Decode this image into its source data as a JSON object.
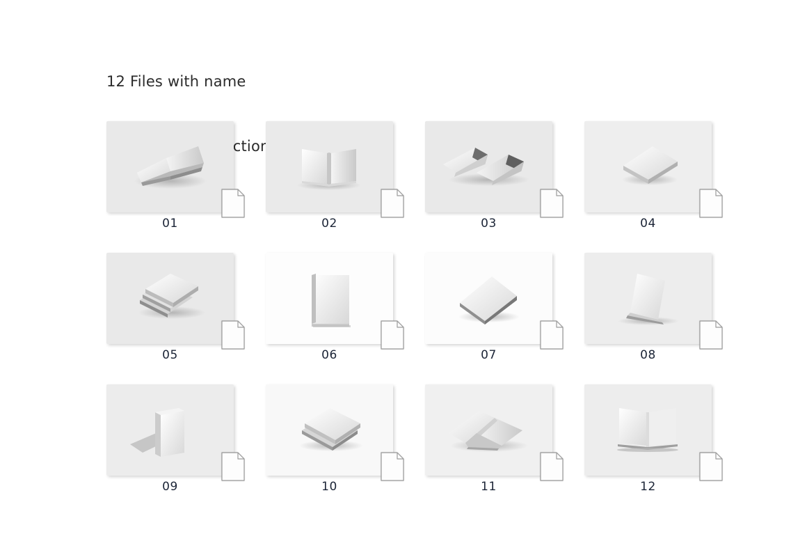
{
  "page": {
    "background_color": "#ffffff"
  },
  "title": {
    "line1": "12 Files with name",
    "line2": "and image instructions",
    "color": "#2b2b2b"
  },
  "gallery": {
    "count": 12,
    "caption_color": "#1b2436",
    "icon_name": "document-page-icon",
    "items": [
      {
        "label": "01",
        "bg": "#e9e9e9",
        "art": "open-book-angled",
        "alt": "open book tilted, pages fanned"
      },
      {
        "label": "02",
        "bg": "#eaeaea",
        "art": "open-book-flat",
        "alt": "open book viewed from front, two pages"
      },
      {
        "label": "03",
        "bg": "#e9e9e9",
        "art": "open-magazine-pair",
        "alt": "two open spreads with dark spines"
      },
      {
        "label": "04",
        "bg": "#eeeeee",
        "art": "closed-book-tilted",
        "alt": "closed book tilted on corner"
      },
      {
        "label": "05",
        "bg": "#e9e9e9",
        "art": "stacked-books",
        "alt": "stack of books angled"
      },
      {
        "label": "06",
        "bg": "#fdfdfd",
        "art": "upright-booklet",
        "alt": "upright closed booklet, front cover"
      },
      {
        "label": "07",
        "bg": "#fcfcfc",
        "art": "flat-book-angle",
        "alt": "closed book flat at an angle"
      },
      {
        "label": "08",
        "bg": "#ededed",
        "art": "leaning-book",
        "alt": "book leaning with open back cover"
      },
      {
        "label": "09",
        "bg": "#ececec",
        "art": "standing-book",
        "alt": "book standing upright with shadow"
      },
      {
        "label": "10",
        "bg": "#f8f8f8",
        "art": "stacked-pair",
        "alt": "two stacked closed books"
      },
      {
        "label": "11",
        "bg": "#f0f0f0",
        "art": "open-book-wide",
        "alt": "wide open book lying flat"
      },
      {
        "label": "12",
        "bg": "#ededed",
        "art": "standing-open-book",
        "alt": "open book standing, pages spread"
      }
    ]
  }
}
